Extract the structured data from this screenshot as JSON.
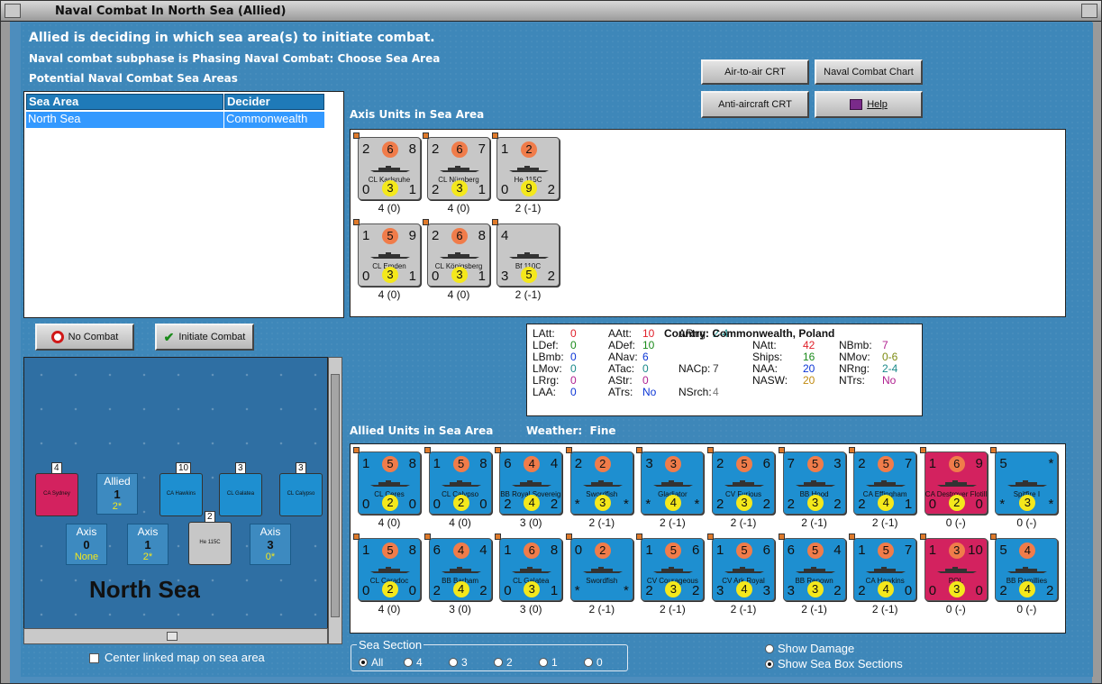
{
  "window": {
    "title": "Naval Combat In North Sea (Allied)"
  },
  "header": {
    "line1": "Allied is deciding in which sea area(s) to initiate combat.",
    "line2": "Naval combat subphase is Phasing Naval Combat: Choose Sea Area",
    "line3": "Potential Naval Combat Sea Areas"
  },
  "buttons": {
    "air_to_air": "Air-to-air CRT",
    "naval_chart": "Naval Combat Chart",
    "anti_aircraft": "Anti-aircraft CRT",
    "help": "Help",
    "no_combat": "No Combat",
    "initiate": "Initiate Combat"
  },
  "sea_table": {
    "headers": [
      "Sea Area",
      "Decider"
    ],
    "rows": [
      [
        "North Sea",
        "Commonwealth"
      ]
    ]
  },
  "axis_title": "Axis Units in Sea Area",
  "axis_units": [
    {
      "name": "CL Karlsruhe",
      "tl": "2",
      "oc": "6",
      "tr": "8",
      "bl": "0",
      "yc": "3",
      "br": "1",
      "below": "4 (0)"
    },
    {
      "name": "CL Nürnberg",
      "tl": "2",
      "oc": "6",
      "tr": "7",
      "bl": "2",
      "yc": "3",
      "br": "1",
      "below": "4 (0)"
    },
    {
      "name": "He 115C",
      "tl": "1",
      "oc": "2",
      "tr": "",
      "bl": "0",
      "yc": "9",
      "br": "2",
      "below": "2 (-1)"
    },
    {
      "name": "CL Emden",
      "tl": "1",
      "oc": "5",
      "tr": "9",
      "bl": "0",
      "yc": "3",
      "br": "1",
      "below": "4 (0)"
    },
    {
      "name": "CL Königsberg",
      "tl": "2",
      "oc": "6",
      "tr": "8",
      "bl": "0",
      "yc": "3",
      "br": "1",
      "below": "4 (0)"
    },
    {
      "name": "Bf 110C",
      "tl": "4",
      "oc": "",
      "tr": "",
      "bl": "3",
      "yc": "5",
      "br": "2",
      "below": "2 (-1)"
    }
  ],
  "info": {
    "country_label": "Country:",
    "country": "Commonwealth, Poland",
    "col1": [
      [
        "LAtt:",
        "0"
      ],
      [
        "LDef:",
        "0"
      ],
      [
        "LBmb:",
        "0"
      ],
      [
        "LMov:",
        "0"
      ],
      [
        "LRrg:",
        "0"
      ],
      [
        "LAA:",
        "0"
      ]
    ],
    "col2": [
      [
        "AAtt:",
        "10"
      ],
      [
        "ADef:",
        "10"
      ],
      [
        "ANav:",
        "6"
      ],
      [
        "ATac:",
        "0"
      ],
      [
        "AStr:",
        "0"
      ],
      [
        "ATrs:",
        "No"
      ]
    ],
    "col3": [
      [
        "ARng:",
        "2-4"
      ],
      [
        "NACp:",
        "7"
      ],
      [
        "NSrch:",
        "4"
      ]
    ],
    "col4": [
      [
        "NAtt:",
        "42"
      ],
      [
        "Ships:",
        "16"
      ],
      [
        "NAA:",
        "20"
      ],
      [
        "NASW:",
        "20"
      ]
    ],
    "col5": [
      [
        "NBmb:",
        "7"
      ],
      [
        "NMov:",
        "0-6"
      ],
      [
        "NRng:",
        "2-4"
      ],
      [
        "NTrs:",
        "No"
      ]
    ]
  },
  "allied_title": "Allied Units in Sea Area",
  "weather_label": "Weather:",
  "weather": "Fine",
  "allied_units": [
    {
      "name": "CL Ceres",
      "c": "blue",
      "tl": "1",
      "oc": "5",
      "tr": "8",
      "bl": "0",
      "yc": "2",
      "br": "0",
      "below": "4 (0)"
    },
    {
      "name": "CL Calypso",
      "c": "blue",
      "tl": "1",
      "oc": "5",
      "tr": "8",
      "bl": "0",
      "yc": "2",
      "br": "0",
      "below": "4 (0)"
    },
    {
      "name": "BB Royal Sovereign",
      "c": "blue",
      "tl": "6",
      "oc": "4",
      "tr": "4",
      "bl": "2",
      "yc": "4",
      "br": "2",
      "below": "3 (0)"
    },
    {
      "name": "Swordfish",
      "c": "blue",
      "tl": "2",
      "oc": "2",
      "tr": "",
      "bl": "*",
      "yc": "3",
      "br": "*",
      "below": "2 (-1)"
    },
    {
      "name": "Gladiator",
      "c": "blue",
      "tl": "3",
      "oc": "3",
      "tr": "",
      "bl": "*",
      "yc": "4",
      "br": "*",
      "below": "2 (-1)"
    },
    {
      "name": "CV Furious",
      "c": "blue",
      "tl": "2",
      "oc": "5",
      "tr": "6",
      "bl": "2",
      "yc": "3",
      "br": "2",
      "below": "2 (-1)"
    },
    {
      "name": "BB Hood",
      "c": "blue",
      "tl": "7",
      "oc": "5",
      "tr": "3",
      "bl": "2",
      "yc": "3",
      "br": "2",
      "below": "2 (-1)"
    },
    {
      "name": "CA Effingham",
      "c": "blue",
      "tl": "2",
      "oc": "5",
      "tr": "7",
      "bl": "2",
      "yc": "4",
      "br": "1",
      "below": "2 (-1)"
    },
    {
      "name": "CA Destroyer Flotilla",
      "c": "mag",
      "tl": "1",
      "oc": "6",
      "tr": "9",
      "bl": "0",
      "yc": "2",
      "br": "0",
      "below": "0 (-)"
    },
    {
      "name": "Spitfire I",
      "c": "blue",
      "tl": "5",
      "oc": "",
      "tr": "*",
      "bl": "*",
      "yc": "3",
      "br": "*",
      "below": "0 (-)"
    },
    {
      "name": "CL Caradoc",
      "c": "blue",
      "tl": "1",
      "oc": "5",
      "tr": "8",
      "bl": "0",
      "yc": "2",
      "br": "0",
      "below": "4 (0)"
    },
    {
      "name": "BB Barham",
      "c": "blue",
      "tl": "6",
      "oc": "4",
      "tr": "4",
      "bl": "2",
      "yc": "4",
      "br": "2",
      "below": "3 (0)"
    },
    {
      "name": "CL Galatea",
      "c": "blue",
      "tl": "1",
      "oc": "6",
      "tr": "8",
      "bl": "0",
      "yc": "3",
      "br": "1",
      "below": "3 (0)"
    },
    {
      "name": "Swordfish",
      "c": "blue",
      "tl": "0",
      "oc": "2",
      "tr": "",
      "bl": "*",
      "yc": "",
      "br": "*",
      "below": "2 (-1)"
    },
    {
      "name": "CV Courageous",
      "c": "blue",
      "tl": "1",
      "oc": "5",
      "tr": "6",
      "bl": "2",
      "yc": "3",
      "br": "2",
      "below": "2 (-1)"
    },
    {
      "name": "CV Ark Royal",
      "c": "blue",
      "tl": "1",
      "oc": "5",
      "tr": "6",
      "bl": "3",
      "yc": "4",
      "br": "3",
      "below": "2 (-1)"
    },
    {
      "name": "BB Renown",
      "c": "blue",
      "tl": "6",
      "oc": "5",
      "tr": "4",
      "bl": "3",
      "yc": "3",
      "br": "2",
      "below": "2 (-1)"
    },
    {
      "name": "CA Hawkins",
      "c": "blue",
      "tl": "1",
      "oc": "5",
      "tr": "7",
      "bl": "2",
      "yc": "4",
      "br": "0",
      "below": "2 (-1)"
    },
    {
      "name": "POL",
      "c": "mag",
      "tl": "1",
      "oc": "3",
      "tr": "10",
      "bl": "0",
      "yc": "3",
      "br": "0",
      "below": "0 (-)"
    },
    {
      "name": "BB Ramillies",
      "c": "blue",
      "tl": "5",
      "oc": "4",
      "tr": "",
      "bl": "2",
      "yc": "4",
      "br": "2",
      "below": "0 (-)"
    }
  ],
  "map": {
    "sea_name": "North Sea",
    "boxes": [
      {
        "title": "Allied",
        "val": "1",
        "sub": "2*"
      },
      {
        "title": "Axis",
        "val": "0",
        "sub": "None"
      },
      {
        "title": "Axis",
        "val": "1",
        "sub": "2*"
      },
      {
        "title": "Axis",
        "val": "3",
        "sub": "0*"
      }
    ],
    "stack_counts": [
      "4",
      "10",
      "3",
      "3",
      "2"
    ],
    "map_counters": [
      "CA Sydney",
      "CA Hawkins",
      "CL Galatea",
      "CL Calypso",
      "He 115C"
    ]
  },
  "center_linked": "Center linked map on sea area",
  "sea_section": {
    "label": "Sea Section",
    "options": [
      "All",
      "4",
      "3",
      "2",
      "1",
      "0"
    ],
    "selected": "All"
  },
  "show_damage": "Show Damage",
  "show_sections": "Show Sea Box Sections",
  "colors": {
    "accent": "#3399ff",
    "red": "#e0202a",
    "green": "#1a8a1a",
    "blue": "#0b35d6",
    "teal": "#1a8a8a",
    "maroon": "#b02090",
    "olive": "#7c8a10"
  }
}
